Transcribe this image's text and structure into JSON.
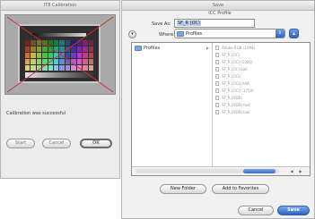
{
  "calibration_window": {
    "title": "IT8 Calibration",
    "message": "Calibration was successful",
    "buttons": {
      "start": "Start",
      "cancel": "Cancel",
      "ok": "OK"
    }
  },
  "save_dialog": {
    "title": "Save",
    "header": "ICC Profile",
    "save_as": {
      "label": "Save As:",
      "value": "SF_R (OC)"
    },
    "where": {
      "label": "Where:",
      "value": "Profiles"
    },
    "sidebar_items": [
      {
        "label": "Profiles"
      }
    ],
    "files": [
      "Adobe RGB (1998)",
      "SF_R (OC)",
      "SF_R (OC) (1000)",
      "SF_R (OC) ball",
      "SF_R (OCI)",
      "SF_R (OCI) AAB",
      "SF_R (OCI) (1750)",
      "SF_R (HDR)",
      "SF_R (HDR) test",
      "SF_R (HDR) ball"
    ],
    "buttons": {
      "new_folder": "New Folder",
      "add_to_favorites": "Add to Favorites",
      "cancel": "Cancel",
      "save": "Save"
    }
  },
  "colors": {
    "accent_blue": "#3569c6",
    "selection": "#b6cff0",
    "crosshair": "#d0303a"
  }
}
